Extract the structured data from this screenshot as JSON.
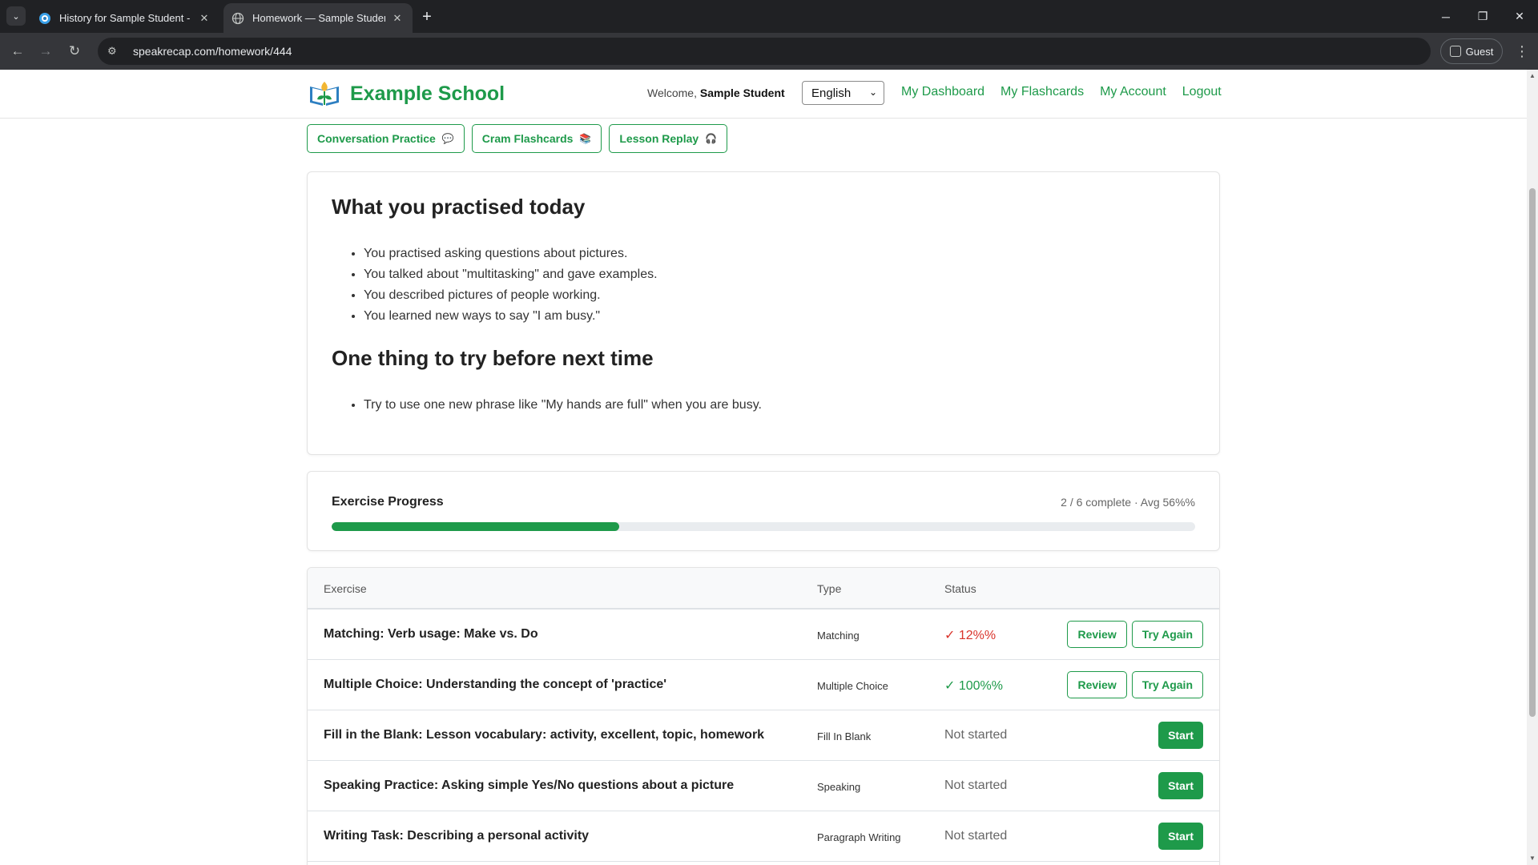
{
  "browser": {
    "tabs": [
      {
        "title": "History for Sample Student - Sp",
        "active": false
      },
      {
        "title": "Homework — Sample Student",
        "active": true
      }
    ],
    "url": "speakrecap.com/homework/444",
    "profile_label": "Guest"
  },
  "header": {
    "brand": "Example School",
    "welcome_prefix": "Welcome,",
    "user_name": "Sample Student",
    "language": "English",
    "nav": [
      "My Dashboard",
      "My Flashcards",
      "My Account",
      "Logout"
    ]
  },
  "quick_links": [
    {
      "label": "Conversation Practice",
      "icon": "speech-bubble-icon"
    },
    {
      "label": "Cram Flashcards",
      "icon": "books-icon"
    },
    {
      "label": "Lesson Replay",
      "icon": "headphones-icon"
    }
  ],
  "summary": {
    "heading": "What you practised today",
    "points": [
      "You practised asking questions about pictures.",
      "You talked about \"multitasking\" and gave examples.",
      "You described pictures of people working.",
      "You learned new ways to say \"I am busy.\""
    ],
    "next_heading": "One thing to try before next time",
    "next_points": [
      "Try to use one new phrase like \"My hands are full\" when you are busy."
    ]
  },
  "progress": {
    "title": "Exercise Progress",
    "summary_text": "2 / 6 complete · Avg 56%%",
    "fraction": 0.333
  },
  "exercises": {
    "headers": [
      "Exercise",
      "Type",
      "Status"
    ],
    "rows": [
      {
        "name": "Matching: Verb usage: Make vs. Do",
        "type": "Matching",
        "status": "✓ 12%%",
        "state": "low",
        "actions": [
          "Review",
          "Try Again"
        ]
      },
      {
        "name": "Multiple Choice: Understanding the concept of 'practice'",
        "type": "Multiple Choice",
        "status": "✓ 100%%",
        "state": "high",
        "actions": [
          "Review",
          "Try Again"
        ]
      },
      {
        "name": "Fill in the Blank: Lesson vocabulary: activity, excellent, topic, homework",
        "type": "Fill In Blank",
        "status": "Not started",
        "state": "none",
        "actions": [
          "Start"
        ]
      },
      {
        "name": "Speaking Practice: Asking simple Yes/No questions about a picture",
        "type": "Speaking",
        "status": "Not started",
        "state": "none",
        "actions": [
          "Start"
        ]
      },
      {
        "name": "Writing Task: Describing a personal activity",
        "type": "Paragraph Writing",
        "status": "Not started",
        "state": "none",
        "actions": [
          "Start"
        ]
      }
    ]
  },
  "colors": {
    "brand_green": "#1e9a4a",
    "low_score_red": "#d9342b",
    "chrome_dark": "#202124"
  }
}
